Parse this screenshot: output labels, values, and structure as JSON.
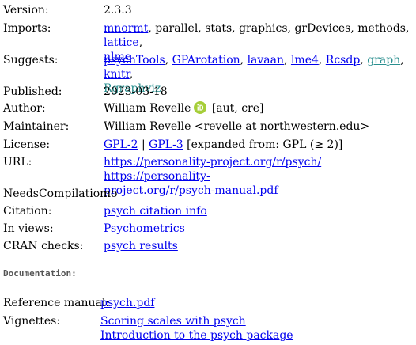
{
  "details": {
    "version": {
      "label": "Version:",
      "value": "2.3.3"
    },
    "imports": {
      "label": "Imports:",
      "items": [
        {
          "text": "mnormt",
          "link": true
        },
        {
          "text": ", parallel, stats, graphics, grDevices, methods, ",
          "link": false
        },
        {
          "text": "lattice",
          "link": true
        },
        {
          "text": ",",
          "link": false
        },
        {
          "text": "nlme",
          "link": true
        }
      ]
    },
    "suggests": {
      "label": "Suggests:",
      "items": [
        {
          "text": "psychTools",
          "link": true
        },
        {
          "text": ", ",
          "link": false
        },
        {
          "text": "GPArotation",
          "link": true
        },
        {
          "text": ", ",
          "link": false
        },
        {
          "text": "lavaan",
          "link": true
        },
        {
          "text": ", ",
          "link": false
        },
        {
          "text": "lme4",
          "link": true
        },
        {
          "text": ", ",
          "link": false
        },
        {
          "text": "Rcsdp",
          "link": true
        },
        {
          "text": ", ",
          "link": false
        },
        {
          "text": "graph",
          "link": true
        },
        {
          "text": ", ",
          "link": false
        },
        {
          "text": "knitr",
          "link": true
        },
        {
          "text": ",",
          "link": false
        },
        {
          "text": "Rgraphviz",
          "link": true
        }
      ]
    },
    "published": {
      "label": "Published:",
      "value": "2023-03-18"
    },
    "author": {
      "label": "Author:",
      "name": "William Revelle",
      "roles": "[aut, cre]",
      "orcid_icon": "orcid-icon"
    },
    "maintainer": {
      "label": "Maintainer:",
      "value": "William Revelle <revelle at northwestern.edu>"
    },
    "license": {
      "label": "License:",
      "link1": "GPL-2",
      "sep": " | ",
      "link2": "GPL-3",
      "suffix": " [expanded from: GPL (≥ 2)]"
    },
    "url": {
      "label": "URL:",
      "link1": "https://personality-project.org/r/psych/",
      "link2_line1": "https://personality-",
      "link2_line2": "project.org/r/psych-manual.pdf"
    },
    "needs_compilation": {
      "label": "NeedsCompilation:",
      "value": "no"
    },
    "citation": {
      "label": "Citation:",
      "link": "psych citation info"
    },
    "in_views": {
      "label": "In views:",
      "link": "Psychometrics"
    },
    "cran_checks": {
      "label": "CRAN checks:",
      "link": "psych results"
    }
  },
  "documentation": {
    "heading": "Documentation:",
    "reference_manual": {
      "label": "Reference manual:",
      "link": "psych.pdf"
    },
    "vignettes": {
      "label": "Vignettes:",
      "links": [
        "Scoring scales with psych",
        "Introduction to the psych package"
      ]
    }
  },
  "colors": {
    "link": "#0000ee",
    "visited_link": "#2a8f8f",
    "orcid_green": "#a6ce39"
  }
}
